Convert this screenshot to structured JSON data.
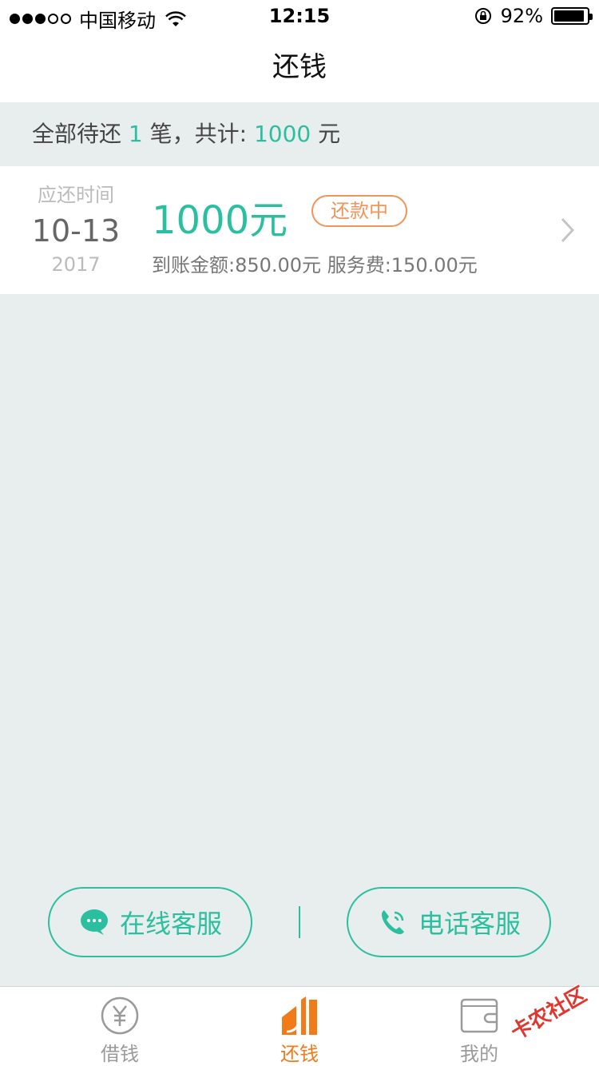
{
  "status_bar": {
    "carrier": "中国移动",
    "time": "12:15",
    "battery_percent": "92%",
    "battery_level": 0.92
  },
  "nav": {
    "title": "还钱"
  },
  "summary": {
    "prefix": "全部待还 ",
    "count": "1",
    "middle": " 笔，共计: ",
    "total": "1000",
    "suffix": " 元"
  },
  "loan": {
    "due_label": "应还时间",
    "due_date": "10-13",
    "due_year": "2017",
    "amount": "1000元",
    "status": "还款中",
    "detail": "到账金额:850.00元 服务费:150.00元"
  },
  "service": {
    "online_label": "在线客服",
    "phone_label": "电话客服"
  },
  "tabs": [
    {
      "label": "借钱",
      "icon": "yuan-circle-icon",
      "active": false
    },
    {
      "label": "还钱",
      "icon": "repay-icon",
      "active": true
    },
    {
      "label": "我的",
      "icon": "wallet-icon",
      "active": false
    }
  ],
  "watermark": "卡农社区",
  "colors": {
    "accent": "#2cbf9f",
    "status_tag": "#f0955b",
    "active_tab": "#f07b18",
    "background": "#e8eeee"
  }
}
